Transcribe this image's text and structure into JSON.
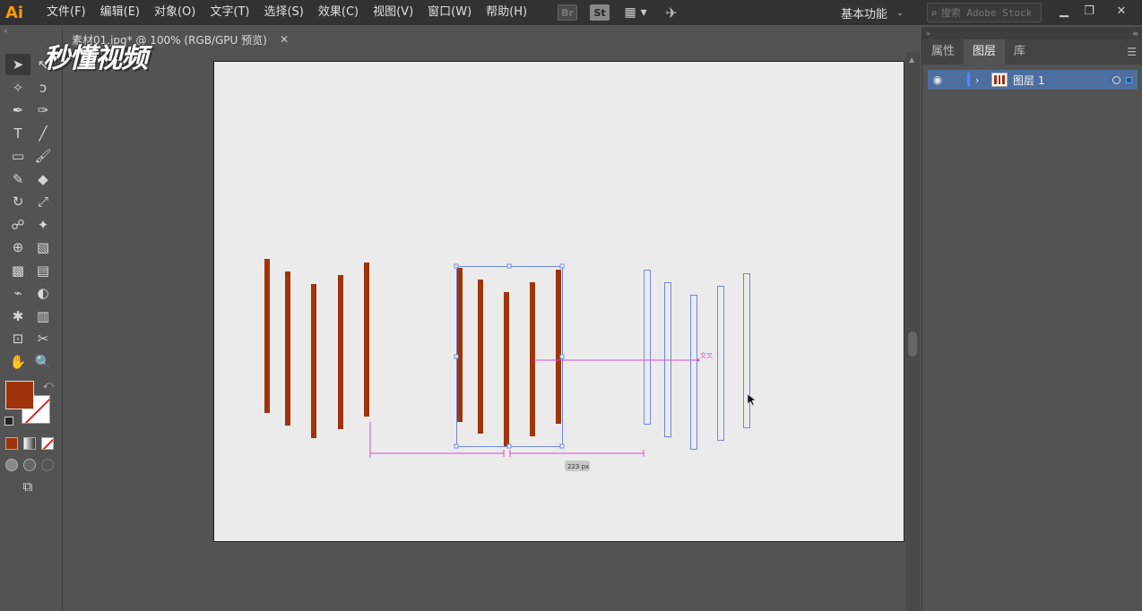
{
  "app": {
    "logo": "Ai"
  },
  "menu": [
    "文件(F)",
    "编辑(E)",
    "对象(O)",
    "文字(T)",
    "选择(S)",
    "效果(C)",
    "视图(V)",
    "窗口(W)",
    "帮助(H)"
  ],
  "bridge_label": "Br",
  "stock_label": "St",
  "workspace": "基本功能",
  "search": {
    "placeholder": "搜索 Adobe Stock"
  },
  "document_tab": {
    "title": "素材01.jpg* @ 100% (RGB/GPU 预览)"
  },
  "panel": {
    "tabs": [
      "属性",
      "图层",
      "库"
    ],
    "active_tab": "图层",
    "layer": {
      "name": "图层 1"
    }
  },
  "watermark": "秒懂视频",
  "canvas": {
    "distance_label": "223 px",
    "snap_label": "交叉",
    "fill_color": "#a0330a",
    "outline_color": "#6f87e0",
    "guide_color": "#d34fd3"
  },
  "colors": {
    "fill": "#a0330a",
    "stroke": "#ffffff"
  }
}
